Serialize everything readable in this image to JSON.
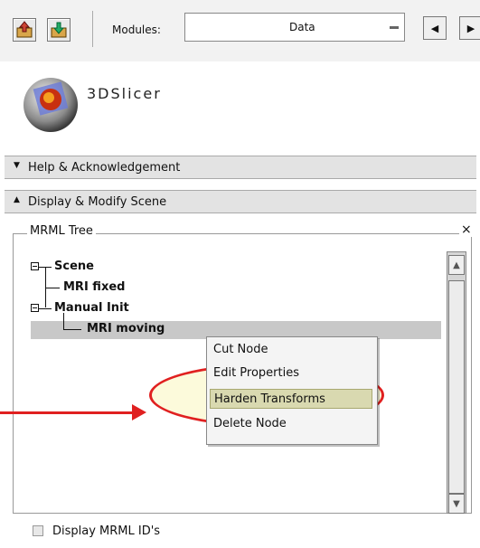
{
  "toolbar": {
    "module_label": "Modules:",
    "module_value": "Data",
    "nav_prev": "◀",
    "nav_next": "▶"
  },
  "logo": {
    "text": "3DSlicer"
  },
  "panels": {
    "help": "Help & Acknowledgement",
    "display": "Display & Modify Scene"
  },
  "tree": {
    "title": "MRML Tree",
    "close": "×",
    "items": [
      "Scene",
      "MRI fixed",
      "Manual Init",
      "MRI moving"
    ]
  },
  "context_menu": {
    "items": [
      "Cut Node",
      "Edit Properties",
      "Harden Transforms",
      "Delete Node"
    ],
    "highlighted_index": 2
  },
  "footer": {
    "checkbox_label": "Display MRML ID's"
  },
  "colors": {
    "annotation": "#e02020",
    "highlight": "#d9d9b0",
    "selection": "#c8c8c8"
  }
}
